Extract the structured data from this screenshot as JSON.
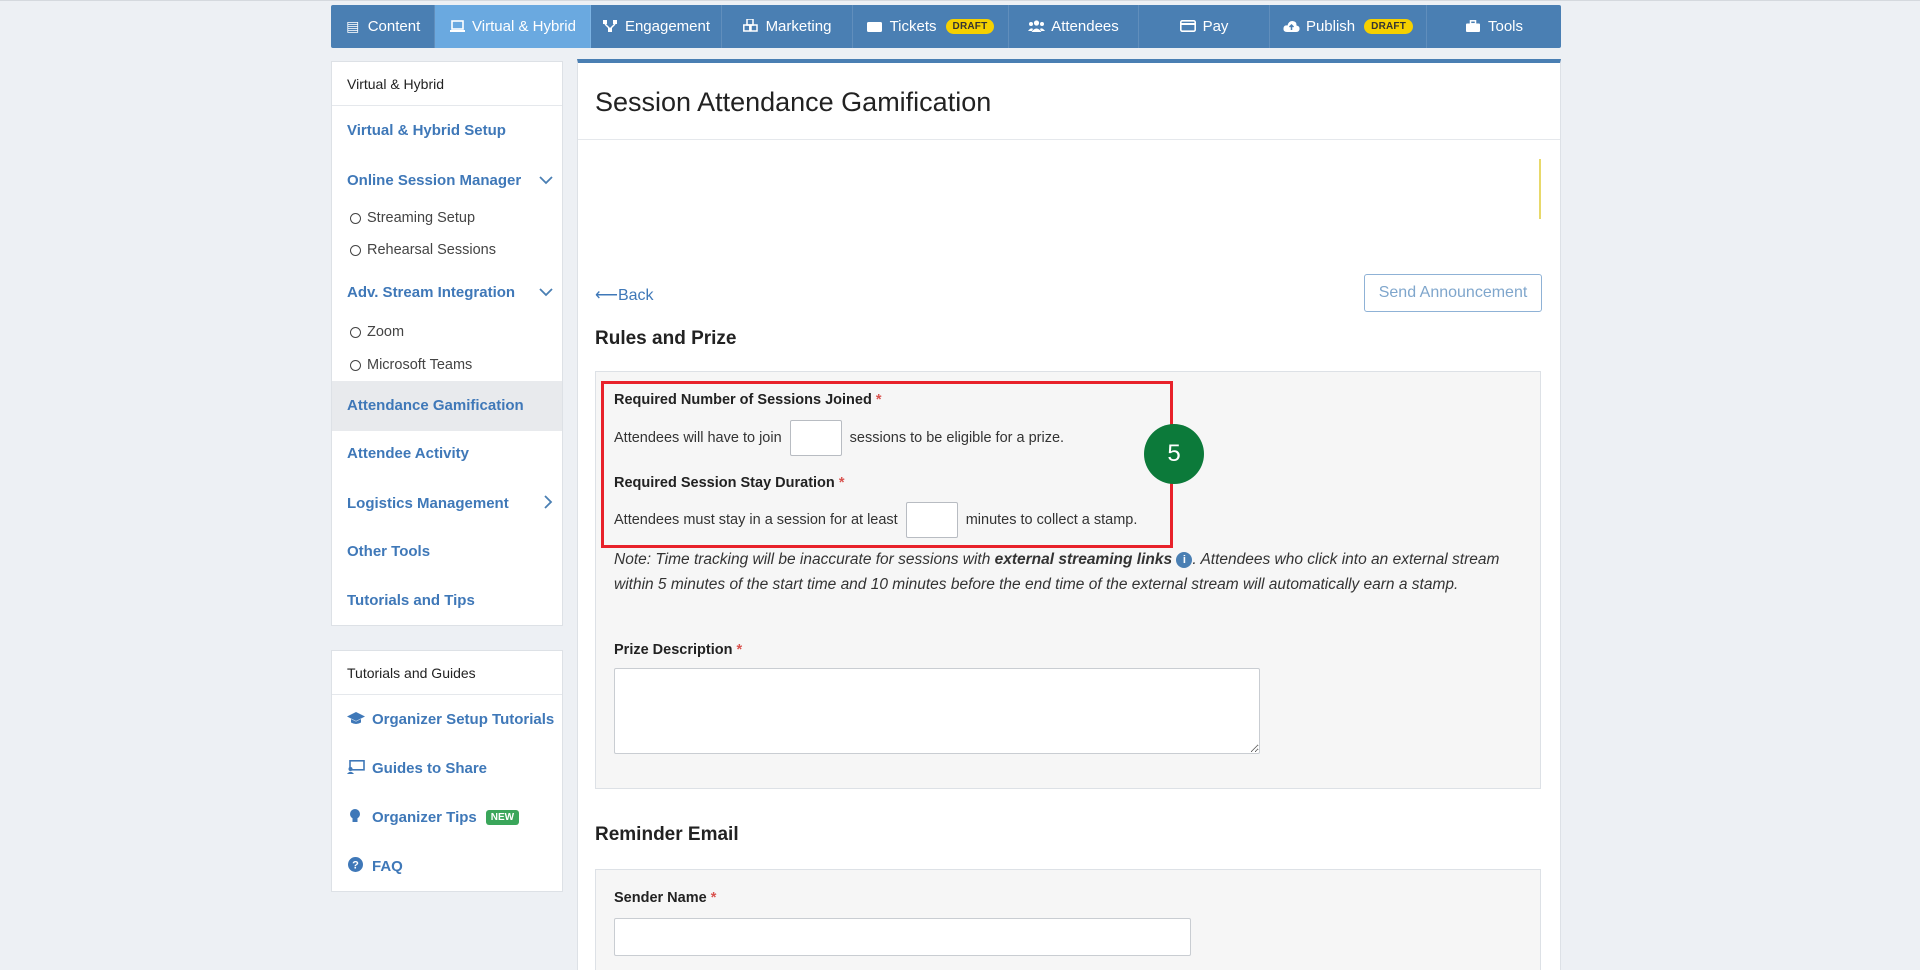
{
  "nav": {
    "items": [
      {
        "label": "Content",
        "icon": "list-icon"
      },
      {
        "label": "Virtual & Hybrid",
        "icon": "laptop-icon",
        "active": true
      },
      {
        "label": "Engagement",
        "icon": "network-icon"
      },
      {
        "label": "Marketing",
        "icon": "cubes-icon"
      },
      {
        "label": "Tickets",
        "icon": "ticket-icon",
        "badge": "DRAFT"
      },
      {
        "label": "Attendees",
        "icon": "users-icon"
      },
      {
        "label": "Pay",
        "icon": "credit-card-icon"
      },
      {
        "label": "Publish",
        "icon": "cloud-upload-icon",
        "badge": "DRAFT"
      },
      {
        "label": "Tools",
        "icon": "toolbox-icon"
      }
    ]
  },
  "sidebar": {
    "heading": "Virtual & Hybrid",
    "setup": "Virtual & Hybrid Setup",
    "online_session_manager": "Online Session Manager",
    "streaming_setup": "Streaming Setup",
    "rehearsal_sessions": "Rehearsal Sessions",
    "adv_stream": "Adv. Stream Integration",
    "zoom": "Zoom",
    "microsoft_teams": "Microsoft Teams",
    "attendance_gamification": "Attendance Gamification",
    "attendee_activity": "Attendee Activity",
    "logistics": "Logistics Management",
    "other_tools": "Other Tools",
    "tutorials_tips": "Tutorials and Tips"
  },
  "guides": {
    "heading": "Tutorials and Guides",
    "organizer_setup": "Organizer Setup Tutorials",
    "guides_to_share": "Guides to Share",
    "organizer_tips": "Organizer Tips",
    "new_badge": "NEW",
    "faq": "FAQ"
  },
  "main": {
    "title": "Session Attendance Gamification",
    "back": "Back",
    "send_announcement": "Send Announcement",
    "rules_title": "Rules and Prize",
    "sessions_label": "Required Number of Sessions Joined",
    "sessions_pre": "Attendees will have to join",
    "sessions_post": "sessions to be eligible for a prize.",
    "duration_label": "Required Session Stay Duration",
    "duration_pre": "Attendees must stay in a session for at least",
    "duration_post": "minutes to collect a stamp.",
    "note_prefix": "Note: Time tracking will be inaccurate for sessions with ",
    "note_bold": "external streaming links",
    "note_suffix": ". Attendees who click into an external stream within 5 minutes of the start time and 10 minutes before the end time of the external stream will automatically earn a stamp.",
    "prize_label": "Prize Description",
    "reminder_title": "Reminder Email",
    "sender_label": "Sender Name",
    "required_mark": "*"
  },
  "annotation": {
    "step": "5",
    "highlight_color": "#e8222b",
    "marker_color": "#0c7a3a"
  }
}
